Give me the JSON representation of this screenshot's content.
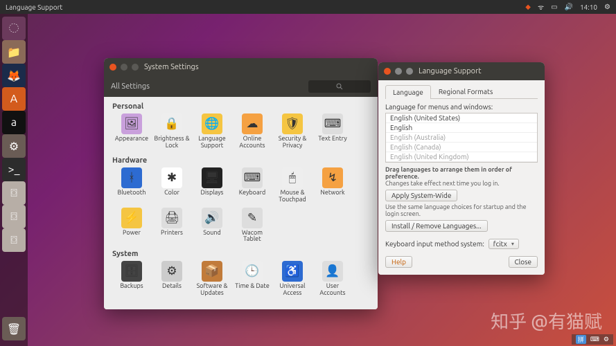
{
  "topbar": {
    "title": "Language Support",
    "time": "14:10"
  },
  "launcher": [
    {
      "name": "dash",
      "bg": "#6b3a5c",
      "glyph": "◌"
    },
    {
      "name": "files",
      "bg": "#8a6a58",
      "glyph": "📁"
    },
    {
      "name": "firefox",
      "bg": "#1b2b4a",
      "glyph": "🦊"
    },
    {
      "name": "ubuntu-software",
      "bg": "#d35b1d",
      "glyph": "A"
    },
    {
      "name": "amazon",
      "bg": "#111",
      "glyph": "a"
    },
    {
      "name": "settings",
      "bg": "#6a5c55",
      "glyph": "⚙"
    },
    {
      "name": "terminal",
      "bg": "#2c2c2c",
      "glyph": ">_"
    },
    {
      "name": "disk1",
      "bg": "#b7aea6",
      "glyph": "⌼"
    },
    {
      "name": "disk2",
      "bg": "#b7aea6",
      "glyph": "⌼"
    },
    {
      "name": "disk3",
      "bg": "#b7aea6",
      "glyph": "⌼"
    }
  ],
  "system_settings": {
    "title": "System Settings",
    "all": "All Settings",
    "personal_label": "Personal",
    "hardware_label": "Hardware",
    "system_label": "System",
    "personal": [
      {
        "name": "appearance",
        "label": "Appearance",
        "glyph": "🖼",
        "bg": "#c9a0dc"
      },
      {
        "name": "brightness",
        "label": "Brightness & Lock",
        "glyph": "🔒",
        "bg": "#eee"
      },
      {
        "name": "language",
        "label": "Language Support",
        "glyph": "🌐",
        "bg": "#f5c542"
      },
      {
        "name": "online-accounts",
        "label": "Online Accounts",
        "glyph": "☁",
        "bg": "#f5a142"
      },
      {
        "name": "security",
        "label": "Security & Privacy",
        "glyph": "🛡",
        "bg": "#f5c542"
      },
      {
        "name": "text-entry",
        "label": "Text Entry",
        "glyph": "⌨",
        "bg": "#ddd"
      }
    ],
    "hardware": [
      {
        "name": "bluetooth",
        "label": "Bluetooth",
        "glyph": "ᚼ",
        "bg": "#2d6bd1"
      },
      {
        "name": "color",
        "label": "Color",
        "glyph": "✱",
        "bg": "#fff"
      },
      {
        "name": "displays",
        "label": "Displays",
        "glyph": "🖥",
        "bg": "#222"
      },
      {
        "name": "keyboard",
        "label": "Keyboard",
        "glyph": "⌨",
        "bg": "#ddd"
      },
      {
        "name": "mouse",
        "label": "Mouse & Touchpad",
        "glyph": "🖱",
        "bg": "#eee"
      },
      {
        "name": "network",
        "label": "Network",
        "glyph": "↯",
        "bg": "#f5a142"
      },
      {
        "name": "power",
        "label": "Power",
        "glyph": "⚡",
        "bg": "#f5c542"
      },
      {
        "name": "printers",
        "label": "Printers",
        "glyph": "🖨",
        "bg": "#ddd"
      },
      {
        "name": "sound",
        "label": "Sound",
        "glyph": "🔊",
        "bg": "#ddd"
      },
      {
        "name": "wacom",
        "label": "Wacom Tablet",
        "glyph": "✎",
        "bg": "#ddd"
      }
    ],
    "system": [
      {
        "name": "backups",
        "label": "Backups",
        "glyph": "🗄",
        "bg": "#444"
      },
      {
        "name": "details",
        "label": "Details",
        "glyph": "⚙",
        "bg": "#ccc"
      },
      {
        "name": "software-updates",
        "label": "Software & Updates",
        "glyph": "📦",
        "bg": "#c17b3a"
      },
      {
        "name": "time-date",
        "label": "Time & Date",
        "glyph": "🕒",
        "bg": "#eee"
      },
      {
        "name": "universal-access",
        "label": "Universal Access",
        "glyph": "♿",
        "bg": "#2d6bd1"
      },
      {
        "name": "user-accounts",
        "label": "User Accounts",
        "glyph": "👤",
        "bg": "#ddd"
      }
    ]
  },
  "language_support": {
    "title": "Language Support",
    "tab_language": "Language",
    "tab_formats": "Regional Formats",
    "label_menus": "Language for menus and windows:",
    "langs": [
      {
        "label": "English (United States)",
        "grey": false
      },
      {
        "label": "English",
        "grey": false
      },
      {
        "label": "English (Australia)",
        "grey": true
      },
      {
        "label": "English (Canada)",
        "grey": true
      },
      {
        "label": "English (United Kingdom)",
        "grey": true
      }
    ],
    "hint_bold": "Drag languages to arrange them in order of preference.",
    "hint_sub": "Changes take effect next time you log in.",
    "apply_btn": "Apply System-Wide",
    "apply_note": "Use the same language choices for startup and the login screen.",
    "install_btn": "Install / Remove Languages...",
    "kbd_label": "Keyboard input method system:",
    "kbd_value": "fcitx",
    "help_btn": "Help",
    "close_btn": "Close"
  },
  "watermark": "知乎 @有猫赋",
  "input_indicator": "拼"
}
